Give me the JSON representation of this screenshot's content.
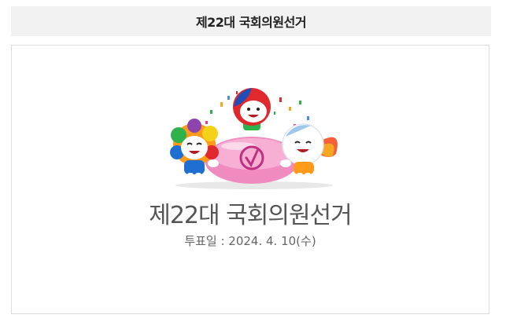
{
  "header": {
    "title": "제22대 국회의원선거"
  },
  "election": {
    "title": "제22대 국회의원선거",
    "date_line": "투표일 : 2024. 4. 10(수)"
  },
  "illustration": {
    "icon": "election-mascots-icon",
    "ballot_mark": "check-circle",
    "colors": {
      "ballot_box": "#f08bc0",
      "left_mascot_hair": "#ff9a1a",
      "left_mascot_body": "#1f6fd1",
      "center_mascot_head": "#e0292d",
      "center_mascot_helmet": "#1f4fb5",
      "center_mascot_body": "#2db34a",
      "right_mascot_wing": "#f5603a",
      "right_mascot_body": "#ff9a1a"
    }
  }
}
